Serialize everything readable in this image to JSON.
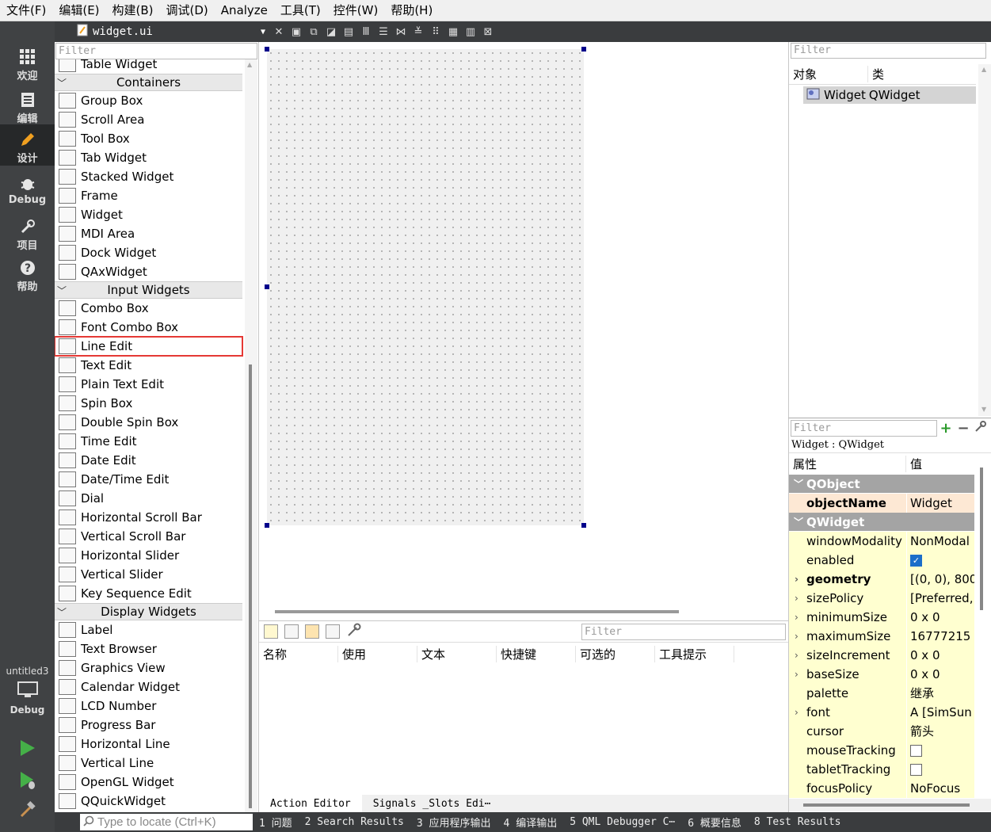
{
  "menubar": [
    "文件(F)",
    "编辑(E)",
    "构建(B)",
    "调试(D)",
    "Analyze",
    "工具(T)",
    "控件(W)",
    "帮助(H)"
  ],
  "modes": [
    {
      "name": "welcome",
      "label": "欢迎",
      "icon": "grid-icon"
    },
    {
      "name": "edit",
      "label": "编辑",
      "icon": "document-icon"
    },
    {
      "name": "design",
      "label": "设计",
      "icon": "pencil-icon"
    },
    {
      "name": "debug",
      "label": "Debug",
      "icon": "bug-icon"
    },
    {
      "name": "project",
      "label": "项目",
      "icon": "wrench-icon"
    },
    {
      "name": "help",
      "label": "帮助",
      "icon": "help-icon"
    }
  ],
  "session": {
    "name": "untitled3",
    "build_label": "Debug"
  },
  "editor": {
    "file": "widget.ui"
  },
  "widgetbox": {
    "filter_placeholder": "Filter",
    "partial_top": "Table Widget",
    "sections": [
      {
        "title": "Containers",
        "items": [
          "Group Box",
          "Scroll Area",
          "Tool Box",
          "Tab Widget",
          "Stacked Widget",
          "Frame",
          "Widget",
          "MDI Area",
          "Dock Widget",
          "QAxWidget"
        ]
      },
      {
        "title": "Input Widgets",
        "items": [
          "Combo Box",
          "Font Combo Box",
          "Line Edit",
          "Text Edit",
          "Plain Text Edit",
          "Spin Box",
          "Double Spin Box",
          "Time Edit",
          "Date Edit",
          "Date/Time Edit",
          "Dial",
          "Horizontal Scroll Bar",
          "Vertical Scroll Bar",
          "Horizontal Slider",
          "Vertical Slider",
          "Key Sequence Edit"
        ]
      },
      {
        "title": "Display Widgets",
        "items": [
          "Label",
          "Text Browser",
          "Graphics View",
          "Calendar Widget",
          "LCD Number",
          "Progress Bar",
          "Horizontal Line",
          "Vertical Line",
          "OpenGL Widget",
          "QQuickWidget"
        ]
      }
    ],
    "highlighted": "Line Edit"
  },
  "action_editor": {
    "filter_placeholder": "Filter",
    "columns": [
      "名称",
      "使用",
      "文本",
      "快捷键",
      "可选的",
      "工具提示"
    ],
    "tabs": [
      "Action Editor",
      "Signals _Slots Edi⋯"
    ]
  },
  "object_inspector": {
    "filter_placeholder": "Filter",
    "col_object": "对象",
    "col_class": "类",
    "row_object": "Widget",
    "row_class": "QWidget"
  },
  "property_editor": {
    "filter_placeholder": "Filter",
    "class_line": "Widget : QWidget",
    "col_property": "属性",
    "col_value": "值",
    "groups": [
      {
        "title": "QObject",
        "rows": [
          {
            "name": "objectName",
            "value": "Widget",
            "bold": true,
            "obj": true,
            "expand": false
          }
        ]
      },
      {
        "title": "QWidget",
        "rows": [
          {
            "name": "windowModality",
            "value": "NonModal",
            "bold": false,
            "expand": false
          },
          {
            "name": "enabled",
            "value": "",
            "checkbox": "on",
            "expand": false
          },
          {
            "name": "geometry",
            "value": "[(0, 0), 800 .",
            "bold": true,
            "expand": true
          },
          {
            "name": "sizePolicy",
            "value": "[Preferred, .",
            "expand": true
          },
          {
            "name": "minimumSize",
            "value": "0 x 0",
            "expand": true
          },
          {
            "name": "maximumSize",
            "value": "16777215 .",
            "expand": true
          },
          {
            "name": "sizeIncrement",
            "value": "0 x 0",
            "expand": true
          },
          {
            "name": "baseSize",
            "value": "0 x 0",
            "expand": true
          },
          {
            "name": "palette",
            "value": "继承",
            "expand": false
          },
          {
            "name": "font",
            "value": "A  [SimSun",
            "expand": true
          },
          {
            "name": "cursor",
            "value": "箭头",
            "expand": false
          },
          {
            "name": "mouseTracking",
            "value": "",
            "checkbox": "off",
            "expand": false
          },
          {
            "name": "tabletTracking",
            "value": "",
            "checkbox": "off",
            "expand": false
          },
          {
            "name": "focusPolicy",
            "value": "NoFocus",
            "expand": false
          }
        ]
      }
    ]
  },
  "statusbar": {
    "locate_placeholder": "Type to locate (Ctrl+K)",
    "tabs": [
      "1 问题",
      "2 Search Results",
      "3 应用程序输出",
      "4 编译输出",
      "5 QML Debugger C⋯",
      "6 概要信息",
      "8 Test Results"
    ]
  }
}
